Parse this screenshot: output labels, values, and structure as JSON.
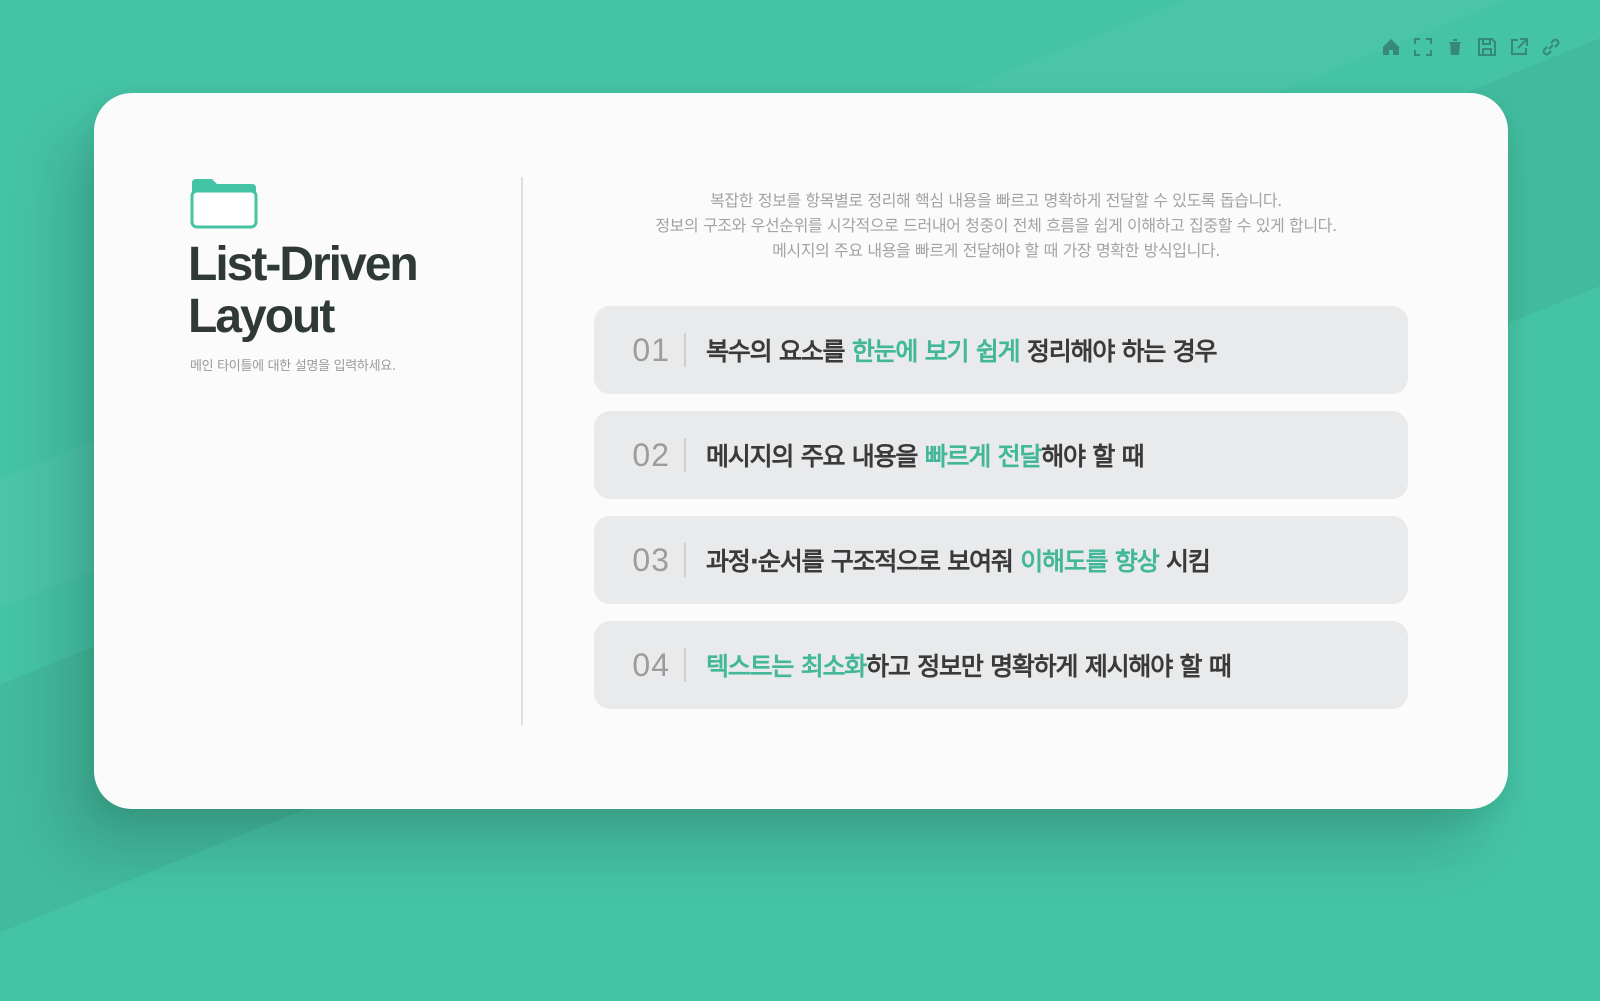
{
  "colors": {
    "background": "#45c3a5",
    "card": "#fbfbfb",
    "accent": "#42b898",
    "item_bg": "#e9eaeb"
  },
  "toolbar": {
    "icons": [
      "home-icon",
      "fullscreen-icon",
      "trash-icon",
      "save-icon",
      "external-link-icon",
      "link-icon"
    ]
  },
  "header": {
    "title": "List-Driven\nLayout",
    "subtitle": "메인 타이틀에 대한 설명을 입력하세요."
  },
  "intro": {
    "line1": "복잡한 정보를 항목별로 정리해 핵심 내용을 빠르고 명확하게 전달할 수 있도록 돕습니다.",
    "line2": "정보의 구조와 우선순위를 시각적으로 드러내어 청중이 전체 흐름을 쉽게 이해하고 집중할 수 있게 합니다.",
    "line3": "메시지의 주요 내용을 빠르게 전달해야 할 때 가장 명확한 방식입니다."
  },
  "items": [
    {
      "num": "01",
      "pre": "복수의 요소를 ",
      "highlight": "한눈에 보기 쉽게",
      "post": " 정리해야 하는 경우"
    },
    {
      "num": "02",
      "pre": "메시지의 주요 내용을 ",
      "highlight": "빠르게 전달",
      "post": "해야 할 때"
    },
    {
      "num": "03",
      "pre": "과정·순서를 구조적으로 보여줘 ",
      "highlight": "이해도를 향상",
      "post": " 시킴"
    },
    {
      "num": "04",
      "pre": "",
      "highlight": "텍스트는 최소화",
      "post": "하고 정보만 명확하게 제시해야 할 때"
    }
  ]
}
